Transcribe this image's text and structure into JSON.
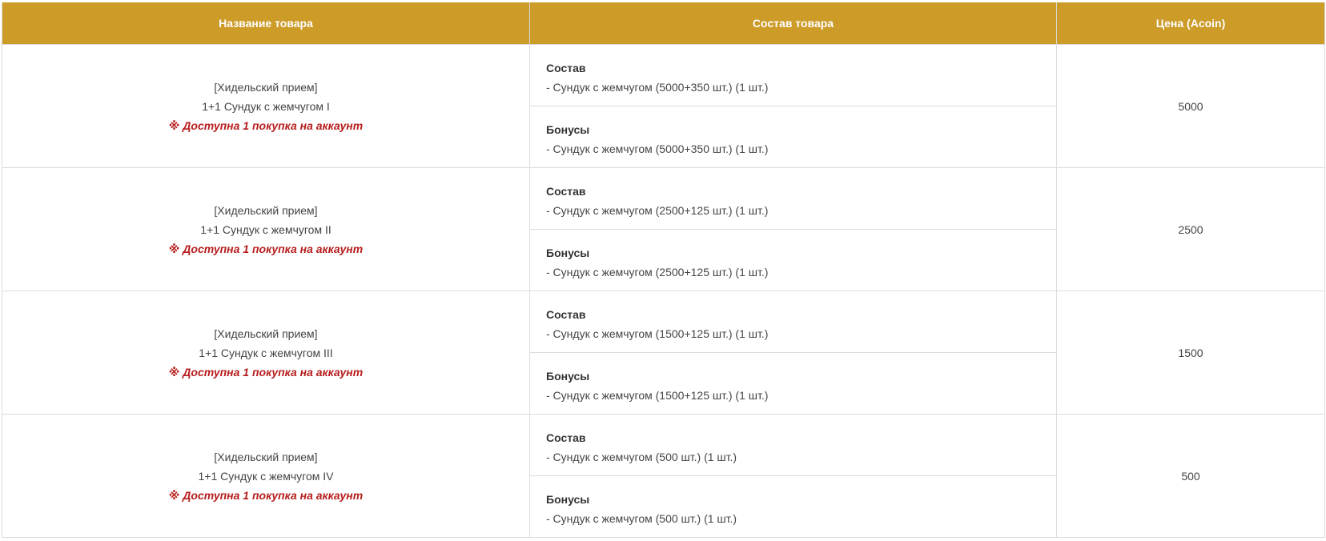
{
  "columns": [
    "Название товара",
    "Состав товара",
    "Цена (Acoin)"
  ],
  "rows": [
    {
      "event": "[Хидельский прием]",
      "product": "1+1 Сундук с жемчугом I",
      "notice": "※ Доступна 1 покупка на аккаунт",
      "sections": [
        {
          "title": "Состав",
          "item": "- Сундук с жемчугом (5000+350 шт.) (1 шт.)"
        },
        {
          "title": "Бонусы",
          "item": "- Сундук с жемчугом (5000+350 шт.) (1 шт.)"
        }
      ],
      "price": "5000"
    },
    {
      "event": "[Хидельский прием]",
      "product": "1+1 Сундук с жемчугом II",
      "notice": "※ Доступна 1 покупка на аккаунт",
      "sections": [
        {
          "title": "Состав",
          "item": "- Сундук с жемчугом (2500+125 шт.) (1 шт.)"
        },
        {
          "title": "Бонусы",
          "item": "- Сундук с жемчугом (2500+125 шт.) (1 шт.)"
        }
      ],
      "price": "2500"
    },
    {
      "event": "[Хидельский прием]",
      "product": "1+1 Сундук с жемчугом III",
      "notice": "※ Доступна 1 покупка на аккаунт",
      "sections": [
        {
          "title": "Состав",
          "item": "- Сундук с жемчугом (1500+125 шт.) (1 шт.)"
        },
        {
          "title": "Бонусы",
          "item": "- Сундук с жемчугом (1500+125 шт.) (1 шт.)"
        }
      ],
      "price": "1500"
    },
    {
      "event": "[Хидельский прием]",
      "product": "1+1 Сундук с жемчугом IV",
      "notice": "※ Доступна 1 покупка на аккаунт",
      "sections": [
        {
          "title": "Состав",
          "item": "- Сундук с жемчугом (500 шт.) (1 шт.)"
        },
        {
          "title": "Бонусы",
          "item": "- Сундук с жемчугом (500 шт.) (1 шт.)"
        }
      ],
      "price": "500"
    }
  ],
  "colors": {
    "header_bg": "#cc9b28",
    "header_text": "#ffffff",
    "notice": "#b71c1c",
    "border": "#dcdcdc",
    "text": "#444444"
  }
}
